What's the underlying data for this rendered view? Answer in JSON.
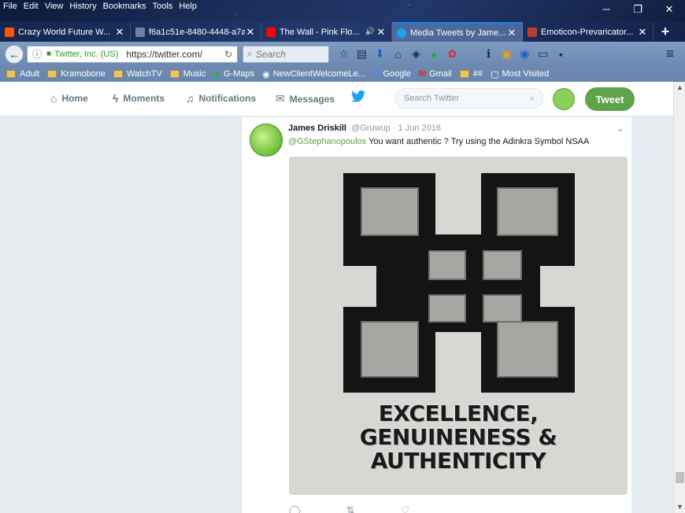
{
  "menu": [
    "File",
    "Edit",
    "View",
    "History",
    "Bookmarks",
    "Tools",
    "Help"
  ],
  "window_controls": {
    "minimize": "─",
    "restore": "❐",
    "close": "✕"
  },
  "tabs": [
    {
      "title": "Crazy World Future W...",
      "favicon_color": "#ff5500",
      "close": "✕",
      "active": false
    },
    {
      "title": "f6a1c51e-8480-4448-a7aa-...",
      "favicon_color": "#6a7fa8",
      "close": "✕",
      "active": false
    },
    {
      "title": "The Wall - Pink Flo...",
      "favicon_color": "#ff0000",
      "close": "✕",
      "active": false,
      "audio": "🔊"
    },
    {
      "title": "Media Tweets by Jame...",
      "favicon_color": "#1da1f2",
      "close": "✕",
      "active": true
    },
    {
      "title": "Emoticon-Prevaricator...",
      "favicon_color": "#c0392b",
      "close": "✕",
      "active": false
    }
  ],
  "new_tab": "+",
  "navbar": {
    "back": "←",
    "info": "ⓘ",
    "org": "Twitter, Inc. (US)",
    "url": "https://twitter.com/",
    "reload": "↻",
    "search_placeholder": "Search",
    "search_icon": "⌕",
    "menu": "≡"
  },
  "bookmarks": [
    {
      "label": "Adult",
      "type": "folder"
    },
    {
      "label": "Kramobone",
      "type": "folder"
    },
    {
      "label": "WatchTV",
      "type": "folder"
    },
    {
      "label": "Music",
      "type": "folder"
    },
    {
      "label": "G-Maps",
      "type": "glyph",
      "glyph": "◆"
    },
    {
      "label": "NewClientWelcomeLe...",
      "type": "glyph",
      "glyph": "◉"
    },
    {
      "label": "Google",
      "type": "glyph",
      "glyph": "G"
    },
    {
      "label": "Gmail",
      "type": "glyph",
      "glyph": "M"
    },
    {
      "label": "##",
      "type": "folder"
    },
    {
      "label": "Most Visited",
      "type": "glyph",
      "glyph": "▢"
    }
  ],
  "twitter_nav": {
    "home": "Home",
    "moments": "Moments",
    "notifications": "Notifications",
    "messages": "Messages",
    "search_placeholder": "Search Twitter",
    "tweet_button": "Tweet"
  },
  "tweet": {
    "name": "James Driskill",
    "handle": "@Gruwup",
    "separator": "·",
    "date": "1 Jun 2016",
    "mention": "@GStephanopoulos",
    "text": " You want authentic ?  Try using the Adinkra Symbol NSAA",
    "image_caption_lines": [
      "EXCELLENCE,",
      "GENUINENESS &",
      "AUTHENTICITY"
    ],
    "actions": {
      "reply": "◯",
      "retweet": "⇅",
      "like": "♡"
    }
  },
  "colors": {
    "twitter_accent": "#5da34a",
    "twitter_blue": "#1da1f2"
  }
}
